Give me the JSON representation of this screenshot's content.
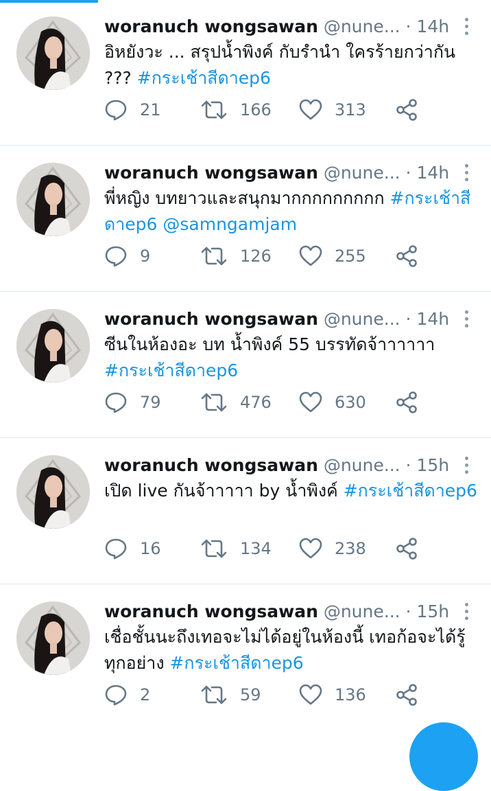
{
  "tabs_indicator_color": "#1da1f2",
  "tweets": [
    {
      "name": "woranuch wongsawan",
      "handle": "@nune...",
      "dot": "·",
      "time": "14h",
      "text": "อิหยังวะ ... สรุปน้ำพิงค์ กับรำนำ ใครร้ายกว่ากัน ??? ",
      "tags": "#กระเช้าสีดาep6",
      "replies": "21",
      "retweets": "166",
      "likes": "313"
    },
    {
      "name": "woranuch wongsawan",
      "handle": "@nune...",
      "dot": "·",
      "time": "14h",
      "text": "พี่หญิง บทยาวและสนุกมากกกกกกกกก ",
      "tags": "#กระเช้าสีดาep6 @samngamjam",
      "replies": "9",
      "retweets": "126",
      "likes": "255"
    },
    {
      "name": "woranuch wongsawan",
      "handle": "@nune...",
      "dot": "·",
      "time": "14h",
      "text": "ซีนในห้องอะ บท น้ำพิงค์ 55 บรรทัดจ้าาาาาา ",
      "tags": "#กระเช้าสีดาep6",
      "replies": "79",
      "retweets": "476",
      "likes": "630"
    },
    {
      "name": "woranuch wongsawan",
      "handle": "@nune...",
      "dot": "·",
      "time": "15h",
      "text": "เปิด live กันจ้าาาาา by น้ำพิงค์ ",
      "tags": "#กระเช้าสีดาep6",
      "replies": "16",
      "retweets": "134",
      "likes": "238"
    },
    {
      "name": "woranuch wongsawan",
      "handle": "@nune...",
      "dot": "·",
      "time": "15h",
      "text": "เชื่อชั้นนะถึงเทอจะไม่ได้อยู่ในห้องนี้ เทอก้อจะได้รู้ทุกอย่าง ",
      "tags": "#กระเช้าสีดาep6",
      "replies": "2",
      "retweets": "59",
      "likes": "136"
    }
  ],
  "icons": {
    "reply": "reply-icon",
    "retweet": "retweet-icon",
    "like": "heart-icon",
    "share": "share-icon",
    "more": "more-vertical-icon"
  },
  "colors": {
    "link": "#1b95e0",
    "secondary": "#657786",
    "icon": "#657786",
    "divider": "#e1e8ed"
  }
}
